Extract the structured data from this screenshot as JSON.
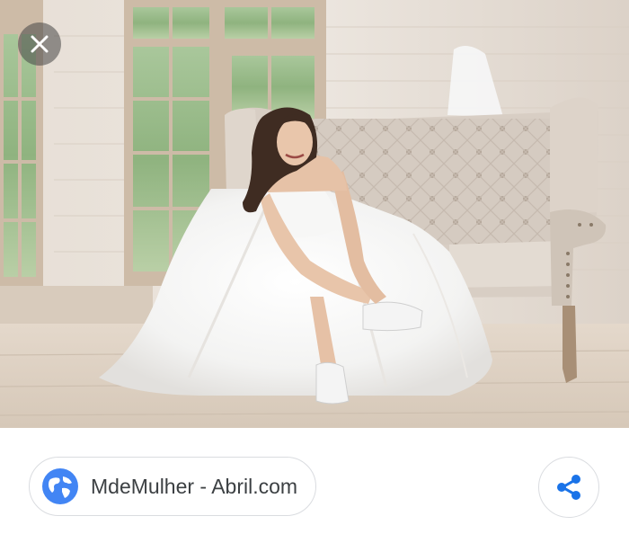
{
  "viewer": {
    "close_icon": "close-icon",
    "image_subject": "bride-photo"
  },
  "source": {
    "label": "MdeMulher - Abril.com",
    "icon": "globe-icon",
    "icon_color": "#4285f4"
  },
  "actions": {
    "share_icon": "share-icon",
    "share_color": "#1a73e8"
  }
}
